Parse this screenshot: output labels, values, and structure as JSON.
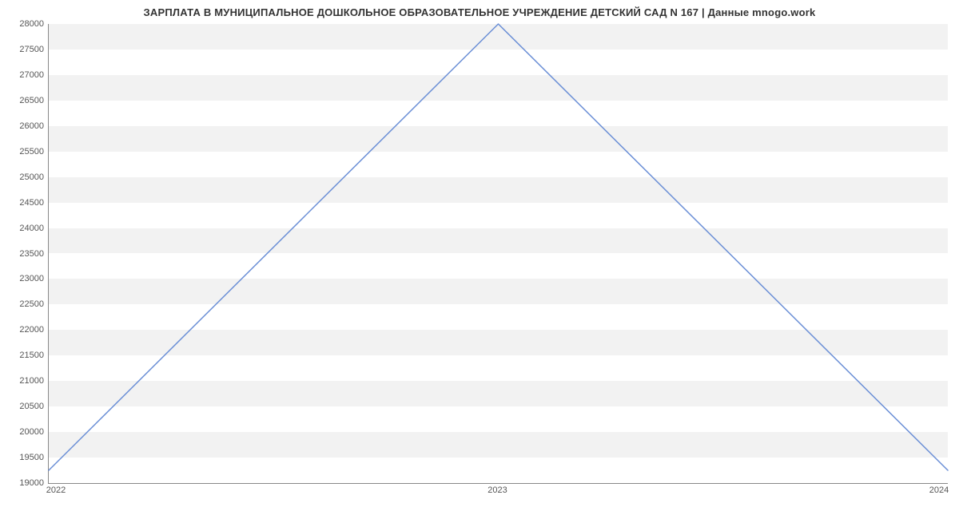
{
  "chart_data": {
    "type": "line",
    "title": "ЗАРПЛАТА В МУНИЦИПАЛЬНОЕ ДОШКОЛЬНОЕ ОБРАЗОВАТЕЛЬНОЕ УЧРЕЖДЕНИЕ ДЕТСКИЙ САД N 167 | Данные mnogo.work",
    "x": [
      2022,
      2023,
      2024
    ],
    "values": [
      19250,
      28000,
      19250
    ],
    "x_ticks": [
      2022,
      2023,
      2024
    ],
    "y_ticks": [
      19000,
      19500,
      20000,
      20500,
      21000,
      21500,
      22000,
      22500,
      23000,
      23500,
      24000,
      24500,
      25000,
      25500,
      26000,
      26500,
      27000,
      27500,
      28000
    ],
    "ylim": [
      19000,
      28000
    ],
    "xlim": [
      2022,
      2024
    ],
    "line_color": "#6b8fd6"
  }
}
